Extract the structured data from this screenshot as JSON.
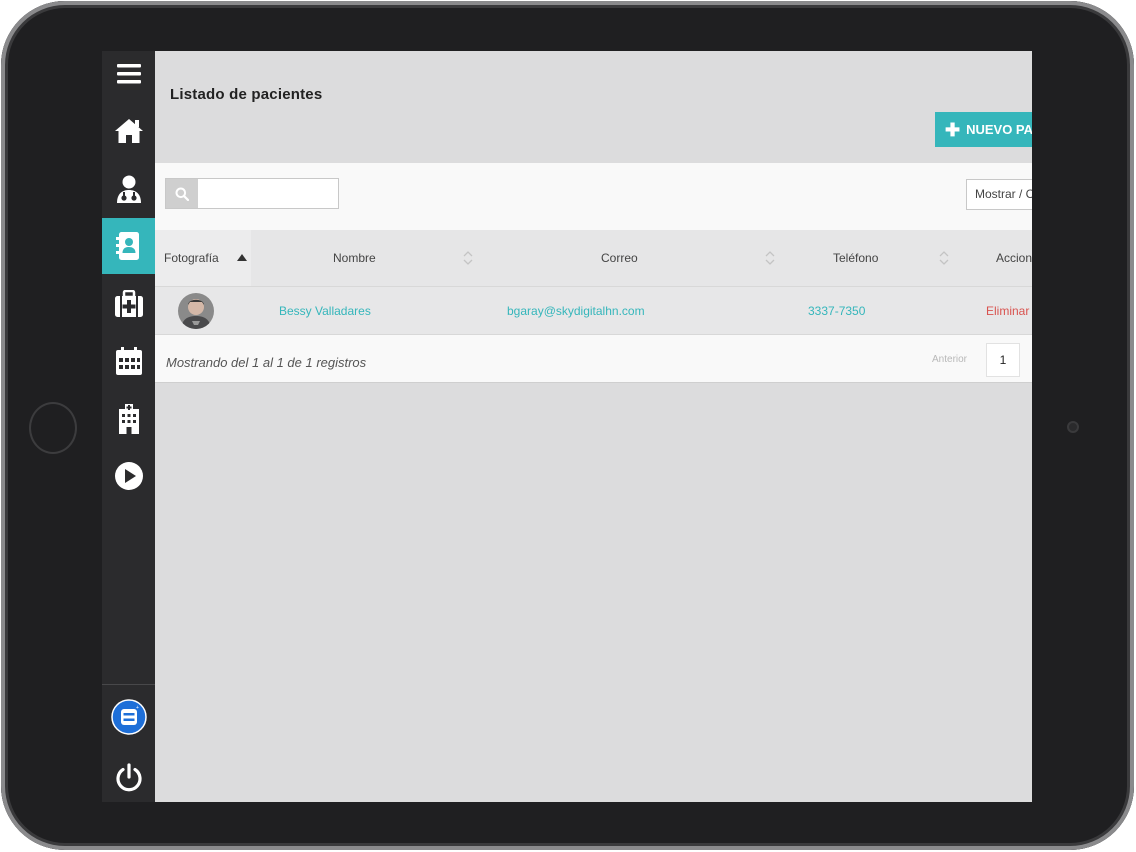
{
  "page": {
    "title": "Listado de pacientes",
    "new_button_label": "NUEVO PA"
  },
  "sidebar": {
    "items": [
      {
        "icon": "menu-icon"
      },
      {
        "icon": "home-icon"
      },
      {
        "icon": "doctor-icon"
      },
      {
        "icon": "patients-icon",
        "active": true
      },
      {
        "icon": "medical-kit-icon"
      },
      {
        "icon": "calendar-icon"
      },
      {
        "icon": "hospital-icon"
      },
      {
        "icon": "play-icon"
      },
      {
        "icon": "app-badge-icon"
      },
      {
        "icon": "power-icon"
      }
    ]
  },
  "search": {
    "placeholder": "",
    "value": ""
  },
  "length_select": {
    "label": "Mostrar / C"
  },
  "table": {
    "columns": [
      "Fotografía",
      "Nombre",
      "Correo",
      "Teléfono",
      "Accion"
    ],
    "rows": [
      {
        "name": "Bessy Valladares",
        "email": "bgaray@skydigitalhn.com",
        "phone": "3337-7350",
        "action": "Eliminar"
      }
    ]
  },
  "footer": {
    "info": "Mostrando del 1 al 1 de 1 registros",
    "prev_label": "Anterior",
    "current_page": "1"
  },
  "colors": {
    "accent": "#35b6bb",
    "sidebar_bg": "#2b2b2d",
    "danger": "#d9534f"
  }
}
